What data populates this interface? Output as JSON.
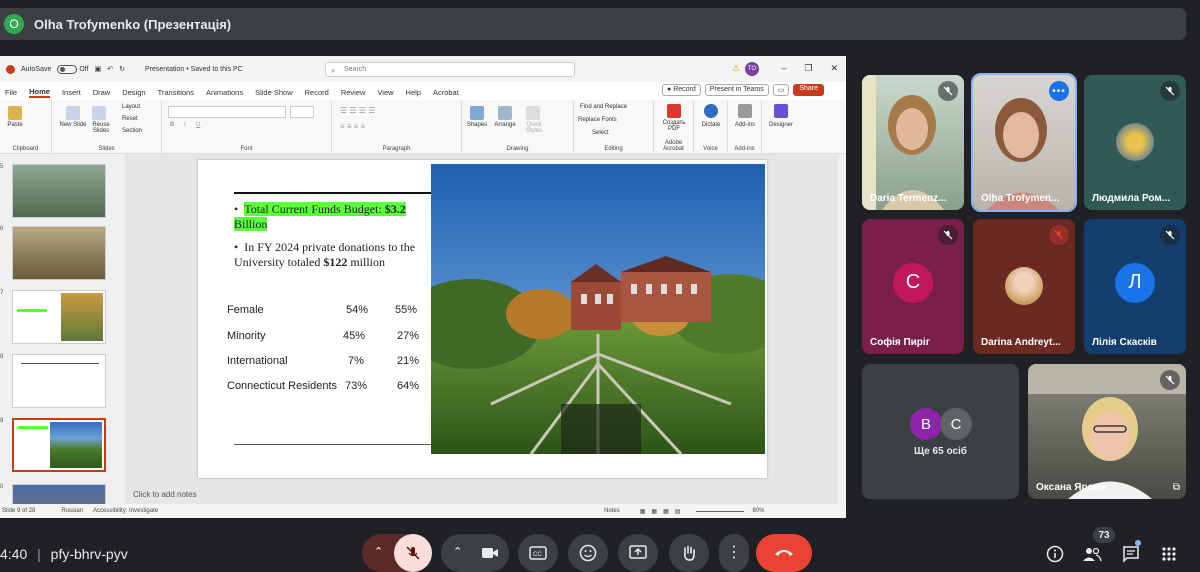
{
  "presenter_bar": {
    "avatar_letter": "O",
    "title": "Olha Trofymenko (Презентація)"
  },
  "ppt": {
    "autosave_label": "AutoSave",
    "autosave_state": "Off",
    "doc_title": "Presentation • Saved to this PC",
    "search_placeholder": "Search",
    "user_initials": "TO",
    "tabs": [
      "File",
      "Home",
      "Insert",
      "Draw",
      "Design",
      "Transitions",
      "Animations",
      "Slide Show",
      "Record",
      "Review",
      "View",
      "Help",
      "Acrobat"
    ],
    "record_btn": "Record",
    "teams_btn": "Present in Teams",
    "share_btn": "Share",
    "ribbon": {
      "paste": "Paste",
      "new_slide": "New Slide",
      "reuse_slides": "Reuse Slides",
      "layout": "Layout",
      "reset": "Reset",
      "section": "Section",
      "clipboard": "Clipboard",
      "slides": "Slides",
      "font": "Font",
      "paragraph": "Paragraph",
      "shapes": "Shapes",
      "arrange": "Arrange",
      "quick_styles": "Quick Styles",
      "drawing": "Drawing",
      "find_replace": "Find and Replace",
      "replace_fonts": "Replace Fonts",
      "select": "Select",
      "editing": "Editing",
      "create_pdf": "Создать PDF",
      "adobe_acrobat": "Adobe Acrobat",
      "dictate": "Dictate",
      "voice": "Voice",
      "addins": "Add-ins",
      "addins_group": "Add-ins",
      "designer": "Designer"
    },
    "thumb_numbers": [
      "5",
      "6",
      "7",
      "8",
      "9",
      "0"
    ],
    "slide": {
      "bullet1_a": "Total Current Funds Budget: ",
      "bullet1_b": "$3.2",
      "bullet1_c": "Billion",
      "bullet2_a": "In FY 2024 private donations to the University totaled ",
      "bullet2_b": "$122",
      "bullet2_c": " million",
      "rows": [
        {
          "label": "Female",
          "v1": "54%",
          "v2": "55%"
        },
        {
          "label": "Minority",
          "v1": "45%",
          "v2": "27%"
        },
        {
          "label": "International",
          "v1": "7%",
          "v2": "21%"
        },
        {
          "label": "Connecticut Residents",
          "v1": "73%",
          "v2": "64%"
        }
      ]
    },
    "notes_placeholder": "Click to add notes",
    "status": {
      "slide": "Slide 9 of 28",
      "language": "Russian",
      "accessibility": "Accessibility: Investigate",
      "notes": "Notes",
      "zoom": "80%"
    }
  },
  "participants": [
    {
      "name": "Daria Termenz...",
      "muted": true
    },
    {
      "name": "Olha Trofymen...",
      "speaking": true
    },
    {
      "name": "Людмила Ром...",
      "muted": true
    },
    {
      "name": "Софія Пиріг",
      "letter": "С",
      "muted": true,
      "color": "#c2185b"
    },
    {
      "name": "Darina Andreyt...",
      "muted": true,
      "mute_color": "#ea4335"
    },
    {
      "name": "Лілія Скаскiв",
      "letter": "Л",
      "muted": true,
      "color": "#1a73e8"
    },
    {
      "name": "Оксана Ярова",
      "muted": true
    }
  ],
  "others": {
    "letters": [
      "В",
      "С"
    ],
    "label": "Ще 65 осіб"
  },
  "bottom": {
    "time": "4:40",
    "meeting_code": "pfy-bhrv-pyv",
    "participant_count": "73"
  },
  "colors": {
    "end_call": "#ea4335",
    "mic_off_bg": "#f9dedc",
    "green_highlight": "#5cff3c"
  }
}
